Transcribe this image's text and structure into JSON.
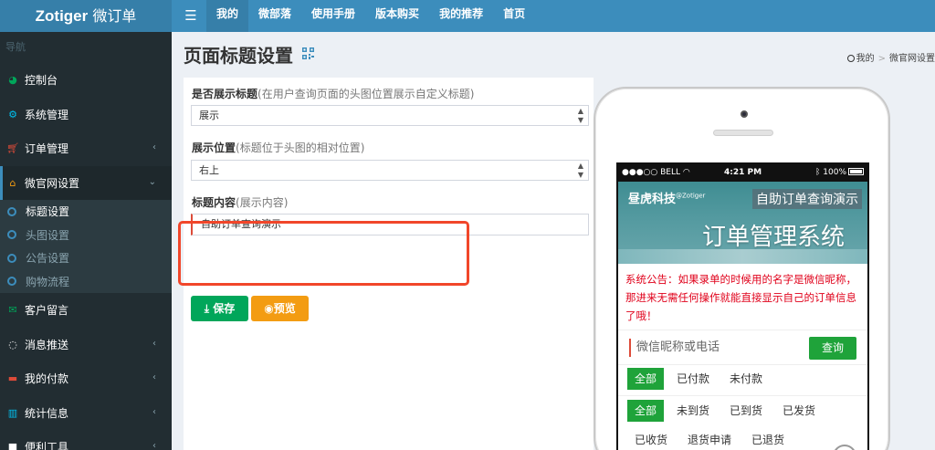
{
  "app": {
    "logo_bold": "Zotiger",
    "logo_rest": " 微订单",
    "menu_icon": "bars-icon"
  },
  "topnav": [
    "我的",
    "微部落",
    "使用手册",
    "版本购买",
    "我的推荐",
    "首页"
  ],
  "sidebar": {
    "header": "导航",
    "items": [
      {
        "label": "控制台",
        "icon": "dashboard-icon",
        "color": "#00a65a"
      },
      {
        "label": "系统管理",
        "icon": "cogs-icon",
        "color": "#00c0ef"
      },
      {
        "label": "订单管理",
        "icon": "cart-icon",
        "color": "#dd4b39"
      },
      {
        "label": "微官网设置",
        "icon": "home-icon",
        "color": "#f39c12"
      }
    ],
    "submenu": [
      "标题设置",
      "头图设置",
      "公告设置",
      "购物流程"
    ],
    "items2": [
      {
        "label": "客户留言",
        "icon": "envelope-icon",
        "color": "#00a65a"
      },
      {
        "label": "消息推送",
        "icon": "comment-icon",
        "color": "#fff"
      },
      {
        "label": "我的付款",
        "icon": "credit-card-icon",
        "color": "#dd4b39"
      },
      {
        "label": "统计信息",
        "icon": "bar-chart-icon",
        "color": "#00c0ef"
      },
      {
        "label": "便利工具",
        "icon": "briefcase-icon",
        "color": "#fff"
      }
    ]
  },
  "page": {
    "title": "页面标题设置",
    "breadcrumb": [
      "我的",
      "微官网设置"
    ]
  },
  "form": {
    "show_title_label": "是否展示标题",
    "show_title_hint": "(在用户查询页面的头图位置展示自定义标题)",
    "show_title_value": "展示",
    "position_label": "展示位置",
    "position_hint": "(标题位于头图的相对位置)",
    "position_value": "右上",
    "content_label": "标题内容",
    "content_hint": "(展示内容)",
    "content_value": "自助订单查询演示",
    "save_label": "保存",
    "preview_label": "预览"
  },
  "phone": {
    "status_left": "●●●○○ BELL",
    "status_time": "4:21 PM",
    "status_right": "100%",
    "brand": "昼虎科技",
    "brand_sup": "@Zotiger",
    "banner_title": "自助订单查询演示",
    "system_name": "订单管理系统",
    "notice": "系统公告：如果录单的时候用的名字是微信昵称，那进来无需任何操作就能直接显示自己的订单信息了哦！",
    "search_placeholder": "微信昵称或电话",
    "search_button": "查询",
    "filter_pay": [
      "全部",
      "已付款",
      "未付款"
    ],
    "filter_ship": [
      "全部",
      "未到货",
      "已到货",
      "已发货"
    ],
    "filter_more": [
      "已收货",
      "退货申请",
      "已退货"
    ]
  },
  "colors": {
    "topbar": "#3c8dbc",
    "sidebar": "#222d32",
    "highlight": "#f1462a",
    "save": "#00a65a",
    "preview": "#f39c12",
    "phone_green": "#1fa33a"
  }
}
